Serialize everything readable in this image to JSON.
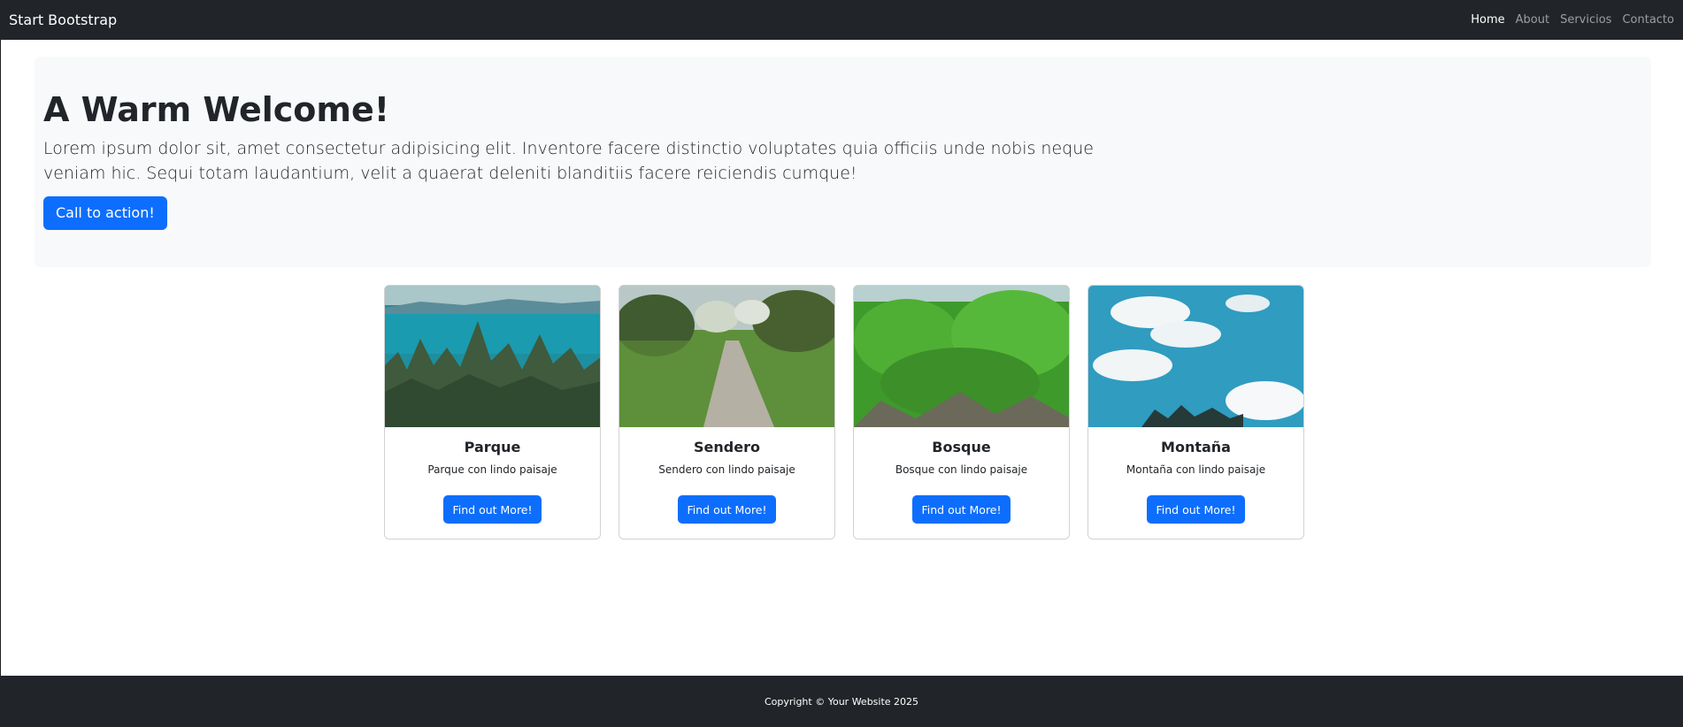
{
  "navbar": {
    "brand": "Start Bootstrap",
    "links": [
      {
        "label": "Home",
        "active": true
      },
      {
        "label": "About",
        "active": false
      },
      {
        "label": "Servicios",
        "active": false
      },
      {
        "label": "Contacto",
        "active": false
      }
    ]
  },
  "hero": {
    "title": "A Warm Welcome!",
    "lead": "Lorem ipsum dolor sit, amet consectetur adipisicing elit. Inventore facere distinctio voluptates quia officiis unde nobis neque veniam hic. Sequi totam laudantium, velit a quaerat deleniti blanditiis facere reiciendis cumque!",
    "cta_label": "Call to action!"
  },
  "cards": [
    {
      "title": "Parque",
      "text": "Parque con lindo paisaje",
      "button": "Find out More!",
      "image": "lake-forest-photo"
    },
    {
      "title": "Sendero",
      "text": "Sendero con lindo paisaje",
      "button": "Find out More!",
      "image": "trail-path-photo"
    },
    {
      "title": "Bosque",
      "text": "Bosque con lindo paisaje",
      "button": "Find out More!",
      "image": "green-forest-photo"
    },
    {
      "title": "Montaña",
      "text": "Montaña con lindo paisaje",
      "button": "Find out More!",
      "image": "sky-clouds-photo"
    }
  ],
  "footer": {
    "copyright": "Copyright © Your Website 2025"
  },
  "colors": {
    "navbar_bg": "#212529",
    "primary": "#0d6efd",
    "hero_bg": "#f8f9fa"
  }
}
